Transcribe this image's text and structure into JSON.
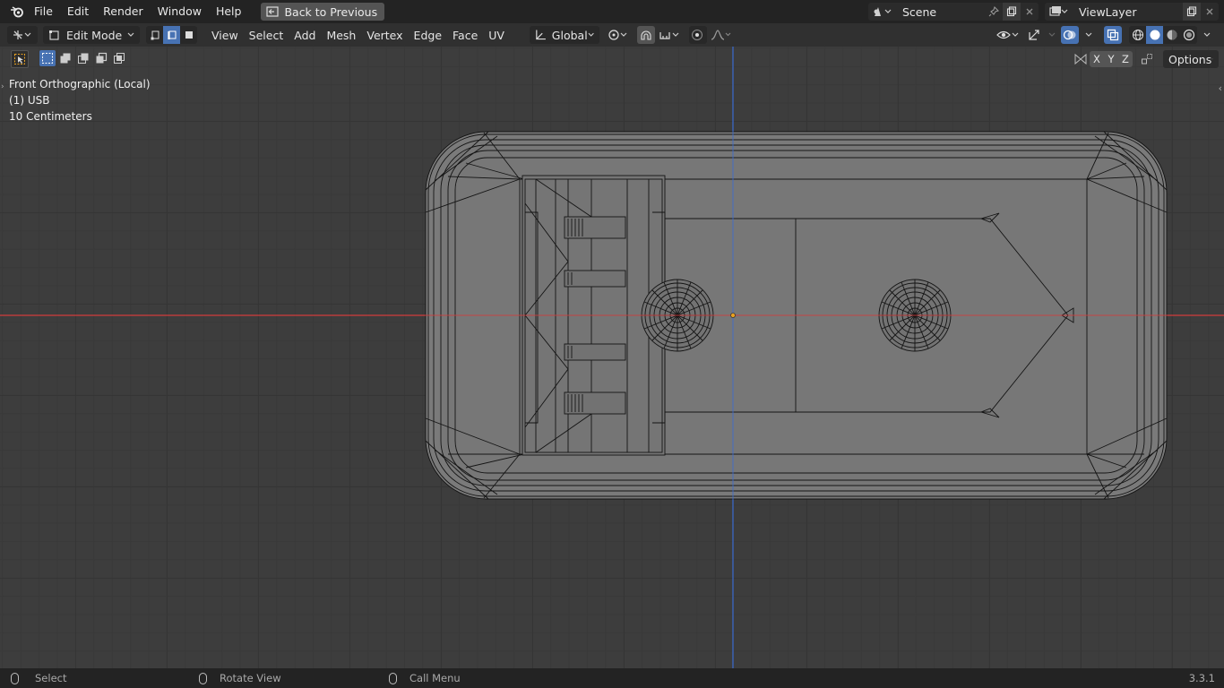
{
  "menubar": {
    "items": [
      "File",
      "Edit",
      "Render",
      "Window",
      "Help"
    ],
    "back_button": "Back to Previous",
    "scene": "Scene",
    "view_layer": "ViewLayer"
  },
  "header": {
    "mode": "Edit Mode",
    "menus": [
      "View",
      "Select",
      "Add",
      "Mesh",
      "Vertex",
      "Edge",
      "Face",
      "UV"
    ],
    "transform_orientation": "Global",
    "select_mode_active": "edge"
  },
  "viewport": {
    "view_name": "Front Orthographic (Local)",
    "object_info": "(1) USB",
    "grid_scale": "10 Centimeters",
    "axes": [
      "X",
      "Y",
      "Z"
    ],
    "options_label": "Options",
    "colors": {
      "background": "#3d3d3d",
      "x_axis": "#d23c3c",
      "z_axis": "#3c6cd0",
      "mesh_fill": "#787878",
      "wire": "#111111",
      "selection": "#4772b3"
    }
  },
  "statusbar": {
    "select": "Select",
    "rotate": "Rotate View",
    "call_menu": "Call Menu",
    "version": "3.3.1"
  }
}
